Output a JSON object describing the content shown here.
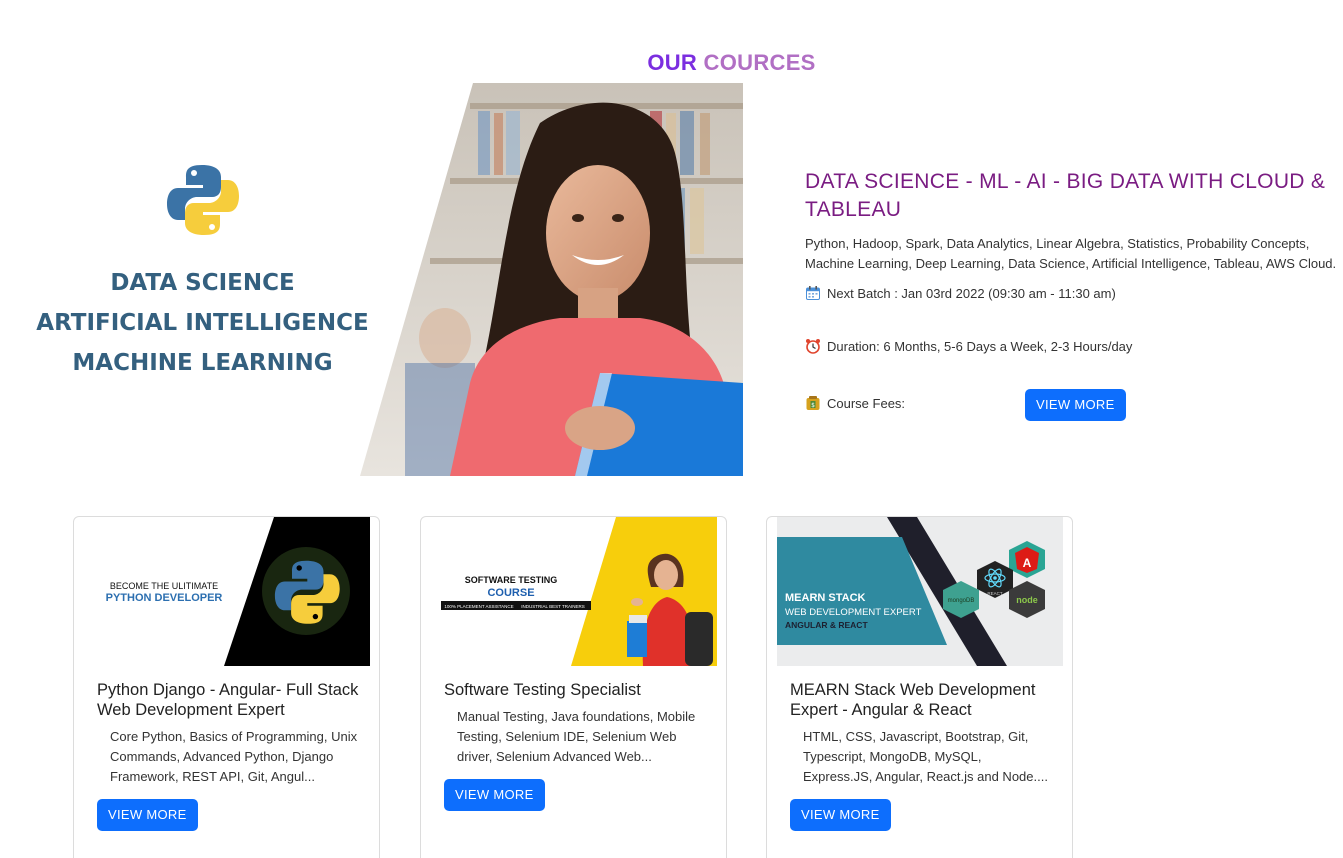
{
  "section": {
    "title_part1": "OUR",
    "title_part2": "COURCES"
  },
  "featured": {
    "banner_lines": [
      "DATA SCIENCE",
      "ARTIFICIAL INTELLIGENCE",
      "MACHINE LEARNING"
    ],
    "title": "DATA SCIENCE - ML - AI - BIG DATA WITH CLOUD & TABLEAU",
    "description": "Python, Hadoop, Spark, Data Analytics, Linear Algebra, Statistics, Probability Concepts, Machine Learning, Deep Learning, Data Science, Artificial Intelligence, Tableau, AWS Cloud.",
    "next_batch": "Next Batch : Jan 03rd 2022 (09:30 am - 11:30 am)",
    "duration": "Duration: 6 Months, 5-6 Days a Week, 2-3 Hours/day",
    "fees_label": "Course Fees:",
    "button_label": "VIEW MORE"
  },
  "cards": [
    {
      "image_line1": "BECOME THE ULITIMATE",
      "image_line2": "PYTHON DEVELOPER",
      "title": "Python Django - Angular- Full Stack Web Development Expert",
      "text": "Core Python, Basics of Programming, Unix Commands, Advanced Python, Django Framework, REST API, Git, Angul...",
      "button_label": "VIEW MORE"
    },
    {
      "image_line1": "SOFTWARE TESTING",
      "image_line2": "COURSE",
      "image_tag1": "100% PLACEMENT ASSISTANCE",
      "image_tag2": "INDUSTRIAL BEST TRAINERS",
      "title": "Software Testing Specialist",
      "text": "Manual Testing, Java foundations, Mobile Testing, Selenium IDE, Selenium Web driver, Selenium Advanced Web...",
      "button_label": "VIEW MORE"
    },
    {
      "image_line1": "MEARN STACK",
      "image_line2": "WEB DEVELOPMENT EXPERT",
      "image_line3": "ANGULAR & REACT",
      "image_hex_react": "REACT",
      "image_hex_mongo": "mongoDB",
      "image_hex_node": "node",
      "title": "MEARN Stack Web Development Expert - Angular & React",
      "text": "HTML, CSS, Javascript, Bootstrap, Git, Typescript, MongoDB, MySQL, Express.JS, Angular, React.js and Node....",
      "button_label": "VIEW MORE"
    }
  ],
  "colors": {
    "title_purple": "#7b2ee0",
    "title_lilac": "#b16fc4",
    "featured_title": "#7a1c82",
    "button": "#0d6efd",
    "banner_text": "#34607f"
  }
}
